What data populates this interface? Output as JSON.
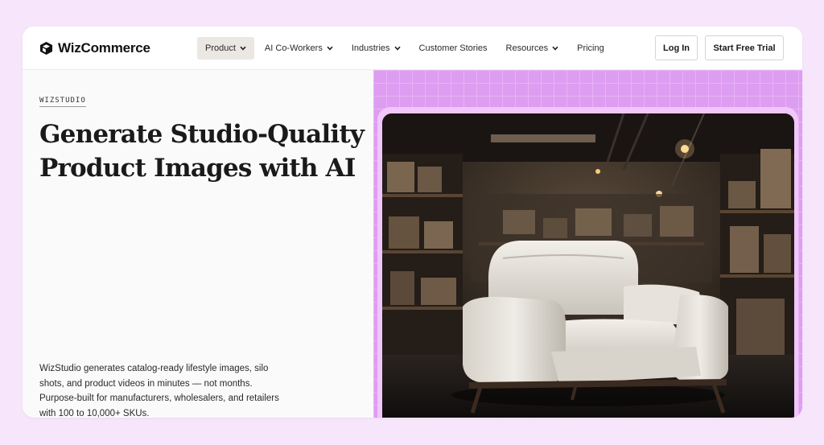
{
  "brand": {
    "name": "WizCommerce",
    "logo_icon": "cube-logo-icon"
  },
  "nav": {
    "items": [
      {
        "label": "Product",
        "has_dropdown": true,
        "active": true
      },
      {
        "label": "AI Co-Workers",
        "has_dropdown": true,
        "active": false
      },
      {
        "label": "Industries",
        "has_dropdown": true,
        "active": false
      },
      {
        "label": "Customer Stories",
        "has_dropdown": false,
        "active": false
      },
      {
        "label": "Resources",
        "has_dropdown": true,
        "active": false
      },
      {
        "label": "Pricing",
        "has_dropdown": false,
        "active": false
      }
    ],
    "login_label": "Log In",
    "trial_label": "Start Free Trial"
  },
  "hero": {
    "eyebrow": "WIZSTUDIO",
    "headline": "Generate Studio-Quality Product Images with AI",
    "description": "WizStudio generates catalog-ready lifestyle images, silo shots, and product videos in minutes — not months. Purpose-built for manufacturers, wholesalers, and retailers with 100 to 10,000+ SKUs.",
    "image": "white-armchair-in-warehouse-photo"
  },
  "colors": {
    "page_bg": "#f7e6fb",
    "pattern": "#dd9df0",
    "frame": "#f0c6fb",
    "active_nav_bg": "#ebe7e3"
  }
}
